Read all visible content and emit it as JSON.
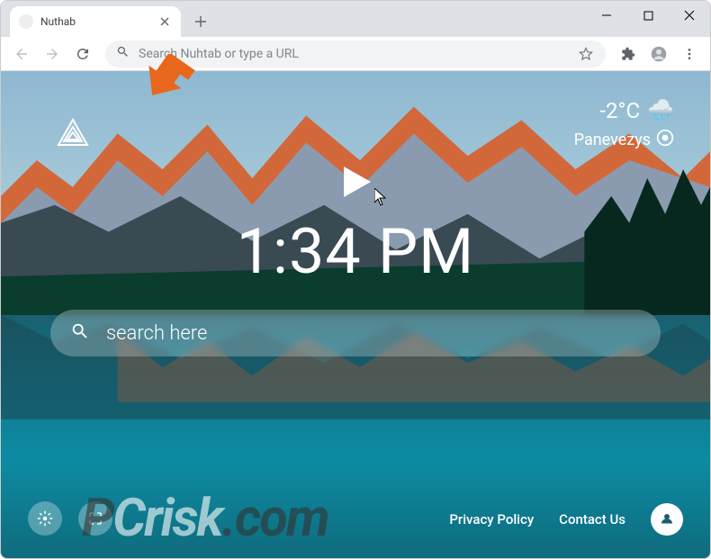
{
  "window": {
    "tab_title": "Nuthab"
  },
  "toolbar": {
    "omnibox_placeholder": "Search Nuhtab or type a URL"
  },
  "page": {
    "weather": {
      "temperature": "-2°C",
      "icon": "🌧️",
      "location": "Panevezys"
    },
    "clock": "1:34 PM",
    "search_placeholder": "search here",
    "footer": {
      "privacy": "Privacy Policy",
      "contact": "Contact Us"
    }
  },
  "watermark": {
    "text_a": "P",
    "text_b": "Crisk",
    "text_c": ".com"
  }
}
